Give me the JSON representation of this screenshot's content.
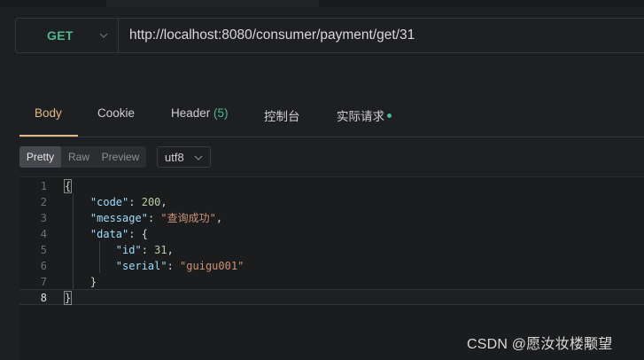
{
  "request": {
    "method": "GET",
    "url": "http://localhost:8080/consumer/payment/get/31"
  },
  "tabs": [
    {
      "label": "Body",
      "active": true
    },
    {
      "label": "Cookie"
    },
    {
      "label": "Header ",
      "count": "(5)"
    },
    {
      "label": "控制台"
    },
    {
      "label": "实际请求"
    }
  ],
  "view_modes": [
    "Pretty",
    "Raw",
    "Preview"
  ],
  "selected_view": "Pretty",
  "encoding": "utf8",
  "response_lines": [
    {
      "num": "1",
      "text": "{"
    },
    {
      "num": "2",
      "indent": "    ",
      "key": "\"code\"",
      "sep": ": ",
      "value": "200",
      "value_type": "number",
      "tail": ","
    },
    {
      "num": "3",
      "indent": "    ",
      "key": "\"message\"",
      "sep": ": ",
      "value": "\"查询成功\"",
      "value_type": "string",
      "tail": ","
    },
    {
      "num": "4",
      "indent": "    ",
      "key": "\"data\"",
      "sep": ": ",
      "tail": "{"
    },
    {
      "num": "5",
      "indent": "        ",
      "key": "\"id\"",
      "sep": ": ",
      "value": "31",
      "value_type": "number",
      "tail": ","
    },
    {
      "num": "6",
      "indent": "        ",
      "key": "\"serial\"",
      "sep": ": ",
      "value": "\"guigu001\"",
      "value_type": "string",
      "tail": ""
    },
    {
      "num": "7",
      "indent": "    ",
      "tail": "}"
    },
    {
      "num": "8",
      "text": "}"
    }
  ],
  "watermark": "CSDN @愿汝妆楼颙望",
  "colors": {
    "method": "#4fb98e",
    "active_tab": "#e2b885",
    "json_key": "#9cdcfe",
    "json_string": "#ce9178",
    "json_number": "#b5cea8"
  },
  "icons": {
    "method_dropdown": "chevron-down-icon",
    "encoding_dropdown": "chevron-down-icon",
    "realtime_indicator": "status-dot-icon"
  }
}
